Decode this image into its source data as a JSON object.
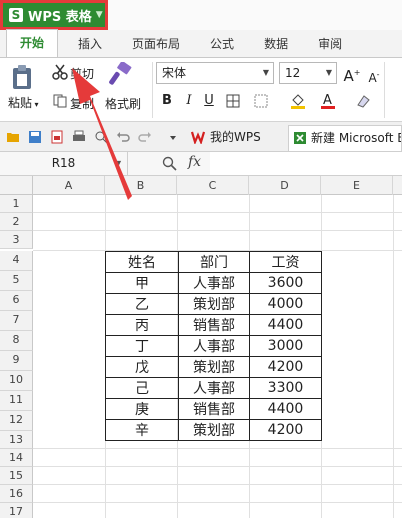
{
  "app": {
    "title": "WPS 表格"
  },
  "ribbon_tabs": [
    {
      "label": "开始",
      "active": true
    },
    {
      "label": "插入"
    },
    {
      "label": "页面布局"
    },
    {
      "label": "公式"
    },
    {
      "label": "数据"
    },
    {
      "label": "审阅"
    }
  ],
  "ribbon": {
    "cut_label": "剪切",
    "paste_label": "粘贴",
    "copy_label": "复制",
    "format_painter_label": "格式刷",
    "font_name": "宋体",
    "font_size": "12",
    "bold_label": "B",
    "italic_label": "I",
    "underline_label": "U",
    "grow_font": "A",
    "shrink_font": "A",
    "font_color_label": "A"
  },
  "quick_access": {
    "doc_tabs": [
      {
        "label": "我的WPS"
      },
      {
        "label": "新建 Microsoft E"
      }
    ]
  },
  "formula_bar": {
    "cell_ref": "R18",
    "fx_label": "fx",
    "value": ""
  },
  "sheet": {
    "columns": [
      "A",
      "B",
      "C",
      "D",
      "E"
    ],
    "rows": [
      "1",
      "2",
      "3",
      "4",
      "5",
      "6",
      "7",
      "8",
      "9",
      "10",
      "11",
      "12",
      "13",
      "14",
      "15",
      "16",
      "17"
    ],
    "table": [
      [
        "姓名",
        "部门",
        "工资"
      ],
      [
        "甲",
        "人事部",
        "3600"
      ],
      [
        "乙",
        "策划部",
        "4000"
      ],
      [
        "丙",
        "销售部",
        "4400"
      ],
      [
        "丁",
        "人事部",
        "3000"
      ],
      [
        "戊",
        "策划部",
        "4200"
      ],
      [
        "己",
        "人事部",
        "3300"
      ],
      [
        "庚",
        "销售部",
        "4400"
      ],
      [
        "辛",
        "策划部",
        "4200"
      ]
    ]
  },
  "colors": {
    "accent_green": "#2e8b32",
    "annotation_red": "#e53a3a"
  }
}
